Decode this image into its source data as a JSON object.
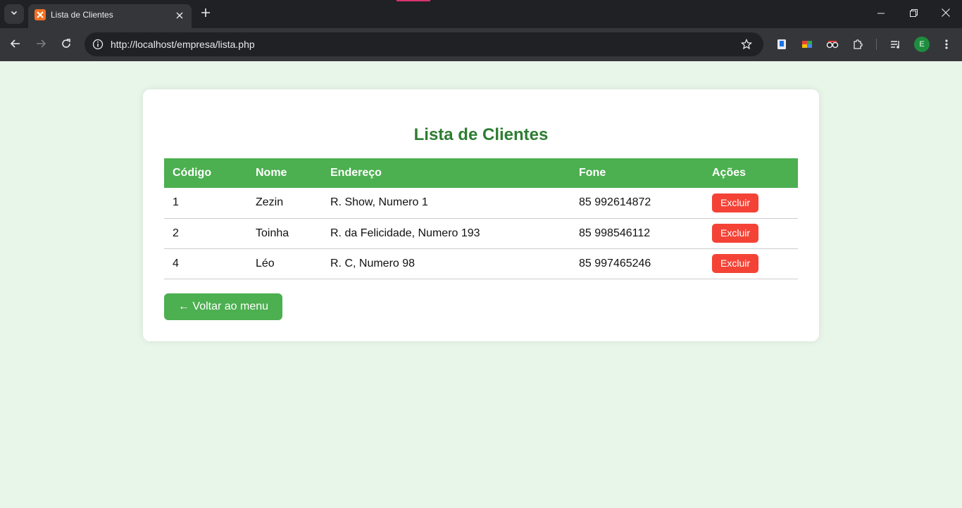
{
  "browser": {
    "tab": {
      "title": "Lista de Clientes"
    },
    "url": "http://localhost/empresa/lista.php",
    "profile_initial": "E",
    "icons": [
      "tab-search-icon",
      "xampp-favicon-icon",
      "close-icon",
      "plus-icon",
      "minimize-icon",
      "restore-icon",
      "close-window-icon",
      "back-arrow-icon",
      "forward-arrow-icon",
      "reload-icon",
      "site-info-icon",
      "star-icon",
      "extension-icon",
      "puzzle-icon",
      "media-queue-icon",
      "kebab-menu-icon"
    ]
  },
  "page": {
    "title": "Lista de Clientes",
    "headers": [
      "Código",
      "Nome",
      "Endereço",
      "Fone",
      "Ações"
    ],
    "rows": [
      {
        "codigo": "1",
        "nome": "Zezin",
        "endereco": "R. Show, Numero 1",
        "fone": "85 992614872",
        "acao": "Excluir"
      },
      {
        "codigo": "2",
        "nome": "Toinha",
        "endereco": "R. da Felicidade, Numero 193",
        "fone": "85 998546112",
        "acao": "Excluir"
      },
      {
        "codigo": "4",
        "nome": "Léo",
        "endereco": "R. C, Numero 98",
        "fone": "85 997465246",
        "acao": "Excluir"
      }
    ],
    "back_button": "← Voltar ao menu"
  },
  "colors": {
    "page_bg": "#e8f5e9",
    "title": "#2e7d32",
    "header_bg": "#4caf50",
    "delete_button": "#f44336"
  }
}
